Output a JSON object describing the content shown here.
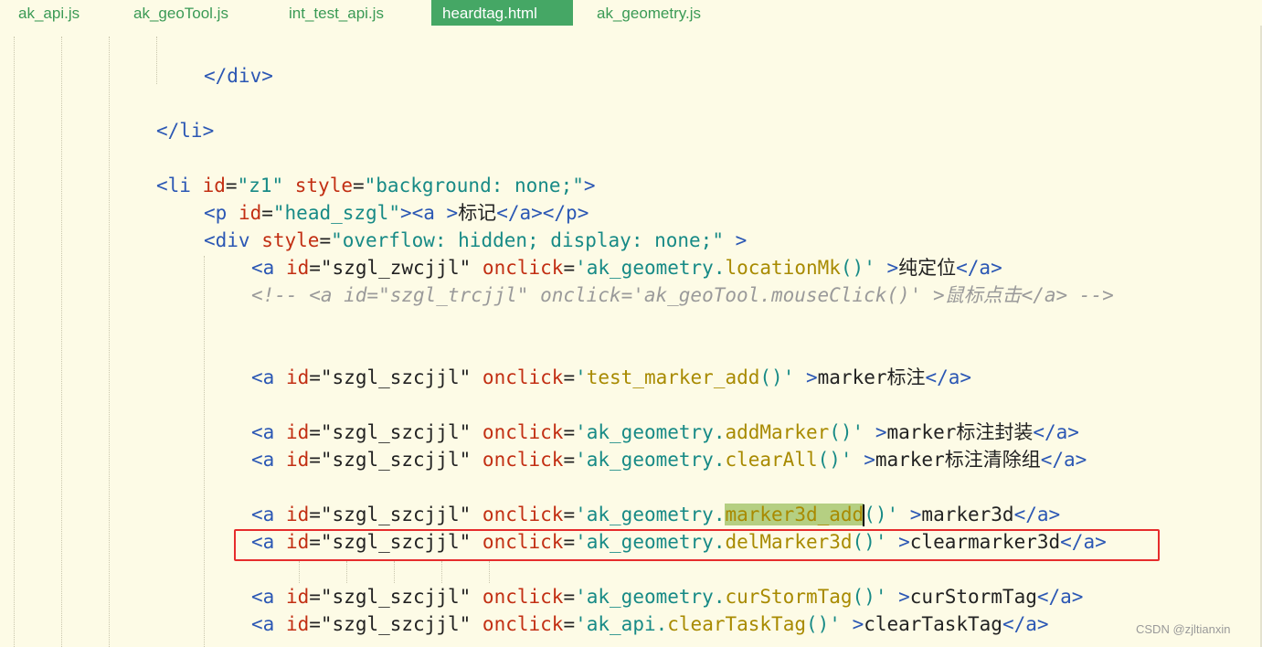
{
  "tabs": [
    {
      "label": "ak_api.js",
      "active": false
    },
    {
      "label": "ak_geoTool.js",
      "active": false
    },
    {
      "label": "int_test_api.js",
      "active": false
    },
    {
      "label": "heardtag.html",
      "active": true
    },
    {
      "label": "ak_geometry.js",
      "active": false
    }
  ],
  "code": {
    "close_div": "</div>",
    "close_li": "</li>",
    "li_open": {
      "t1": "<li ",
      "a1": "id",
      "s1": "\"z1\"",
      "a2": "style",
      "s2": "\"background: none;\"",
      "t2": ">"
    },
    "p_line": {
      "t1": "<p ",
      "a1": "id",
      "s1": "\"head_szgl\"",
      "t2": "><a >",
      "text": "标记",
      "t3": "</a></p>"
    },
    "div_open": {
      "t1": "<div ",
      "a1": "style",
      "s1": "\"overflow: hidden; display: none;\"",
      "t2": " >"
    },
    "a1": {
      "id": "\"szgl_zwcjjl\"",
      "obj": "ak_geometry.",
      "fn": "locationMk",
      "text": "纯定位"
    },
    "comment": "<!-- <a id=\"szgl_trcjjl\" onclick='ak_geoTool.mouseClick()' >鼠标点击</a> -->",
    "a2": {
      "id": "\"szgl_szcjjl\"",
      "fn": "test_marker_add",
      "text": "marker标注"
    },
    "a3": {
      "id": "\"szgl_szcjjl\"",
      "obj": "ak_geometry.",
      "fn": "addMarker",
      "text": "marker标注封装"
    },
    "a4": {
      "id": "\"szgl_szcjjl\"",
      "obj": "ak_geometry.",
      "fn": "clearAll",
      "text": "marker标注清除组"
    },
    "a5": {
      "id": "\"szgl_szcjjl\"",
      "obj": "ak_geometry.",
      "fn": "marker3d_add",
      "text": "marker3d"
    },
    "a6": {
      "id": "\"szgl_szcjjl\"",
      "obj": "ak_geometry.",
      "fn": "delMarker3d",
      "text": "clearmarker3d"
    },
    "a7": {
      "id": "\"szgl_szcjjl\"",
      "obj": "ak_geometry.",
      "fn": "curStormTag",
      "text": "curStormTag"
    },
    "a8": {
      "id": "\"szgl_szcjjl\"",
      "obj": "ak_api.",
      "fn": "clearTaskTag",
      "text": "clearTaskTag"
    },
    "kw": {
      "a_open": "<a ",
      "id_attr": "id",
      "onclick_attr": "onclick",
      "eq": "=",
      "q_open": "'",
      "q_close": "()'",
      "gt": " >",
      "a_close": "</a>"
    }
  },
  "watermark": "CSDN @zjltianxin"
}
